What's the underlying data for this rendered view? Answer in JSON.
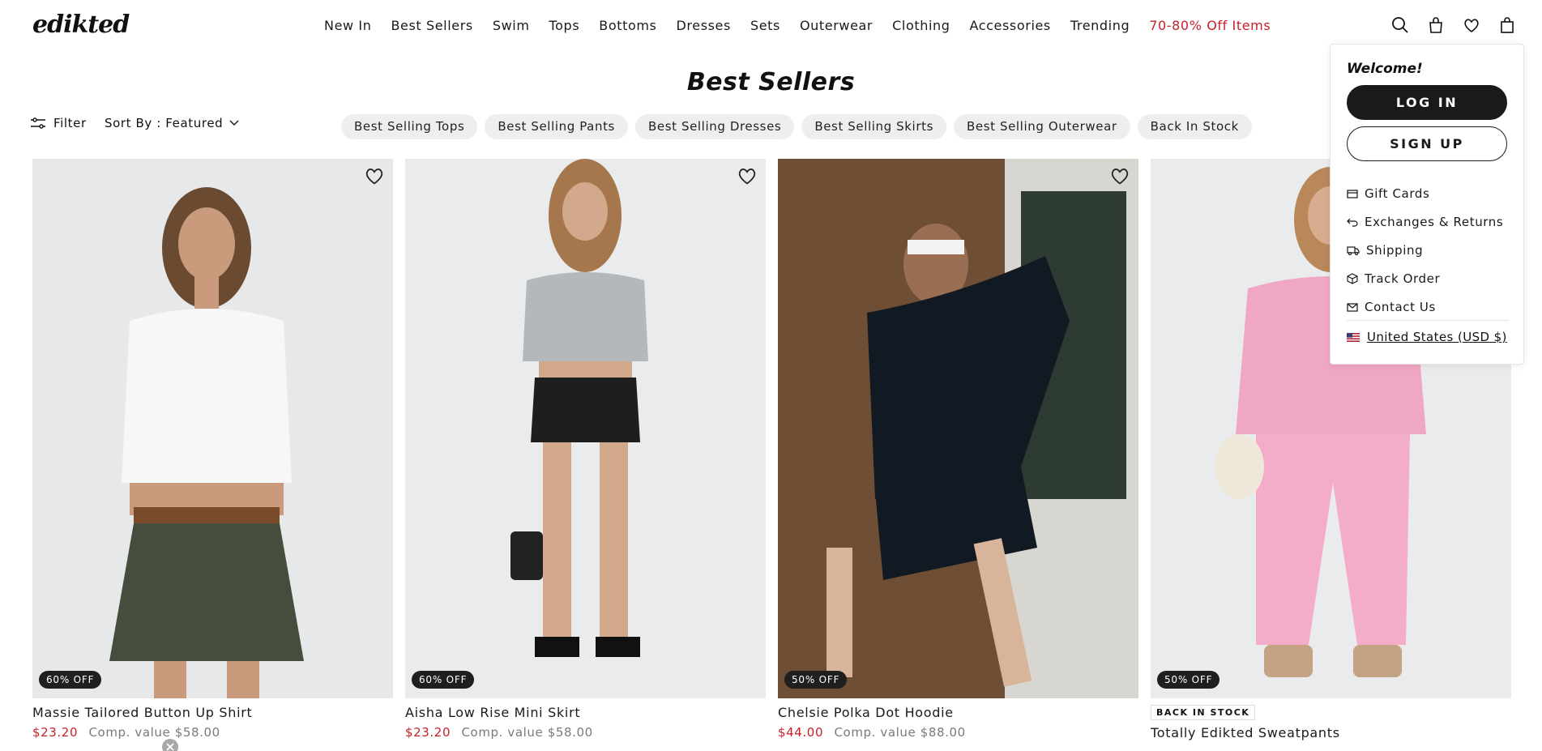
{
  "brand": {
    "logo_text": "edikted"
  },
  "nav": {
    "items": [
      "New In",
      "Best Sellers",
      "Swim",
      "Tops",
      "Bottoms",
      "Dresses",
      "Sets",
      "Outerwear",
      "Clothing",
      "Accessories",
      "Trending"
    ],
    "sale": "70-80% Off Items"
  },
  "header_icons": [
    "search-icon",
    "bag-icon",
    "heart-icon",
    "cart-icon"
  ],
  "page": {
    "title": "Best Sellers"
  },
  "toolbar": {
    "filter_label": "Filter",
    "sort_label": "Sort By : Featured"
  },
  "chips": [
    "Best Selling Tops",
    "Best Selling Pants",
    "Best Selling Dresses",
    "Best Selling Skirts",
    "Best Selling Outerwear",
    "Back In Stock"
  ],
  "products": [
    {
      "name": "Massie Tailored Button Up Shirt",
      "price": "$23.20",
      "comp": "Comp. value $58.00",
      "badge": "60% OFF",
      "stock": ""
    },
    {
      "name": "Aisha Low Rise Mini Skirt",
      "price": "$23.20",
      "comp": "Comp. value $58.00",
      "badge": "60% OFF",
      "stock": ""
    },
    {
      "name": "Chelsie Polka Dot Hoodie",
      "price": "$44.00",
      "comp": "Comp. value $88.00",
      "badge": "50% OFF",
      "stock": ""
    },
    {
      "name": "Totally Edikted Sweatpants",
      "price": "",
      "comp": "",
      "badge": "50% OFF",
      "stock": "BACK IN STOCK"
    }
  ],
  "account_menu": {
    "welcome": "Welcome!",
    "login": "LOG IN",
    "signup": "SIGN UP",
    "links": [
      "Gift Cards",
      "Exchanges & Returns",
      "Shipping",
      "Track Order",
      "Contact Us"
    ],
    "region": "United States (USD $)"
  },
  "colors": {
    "sale": "#c8202a",
    "dark": "#1a1a1a",
    "chip_bg": "#eeeeee"
  }
}
